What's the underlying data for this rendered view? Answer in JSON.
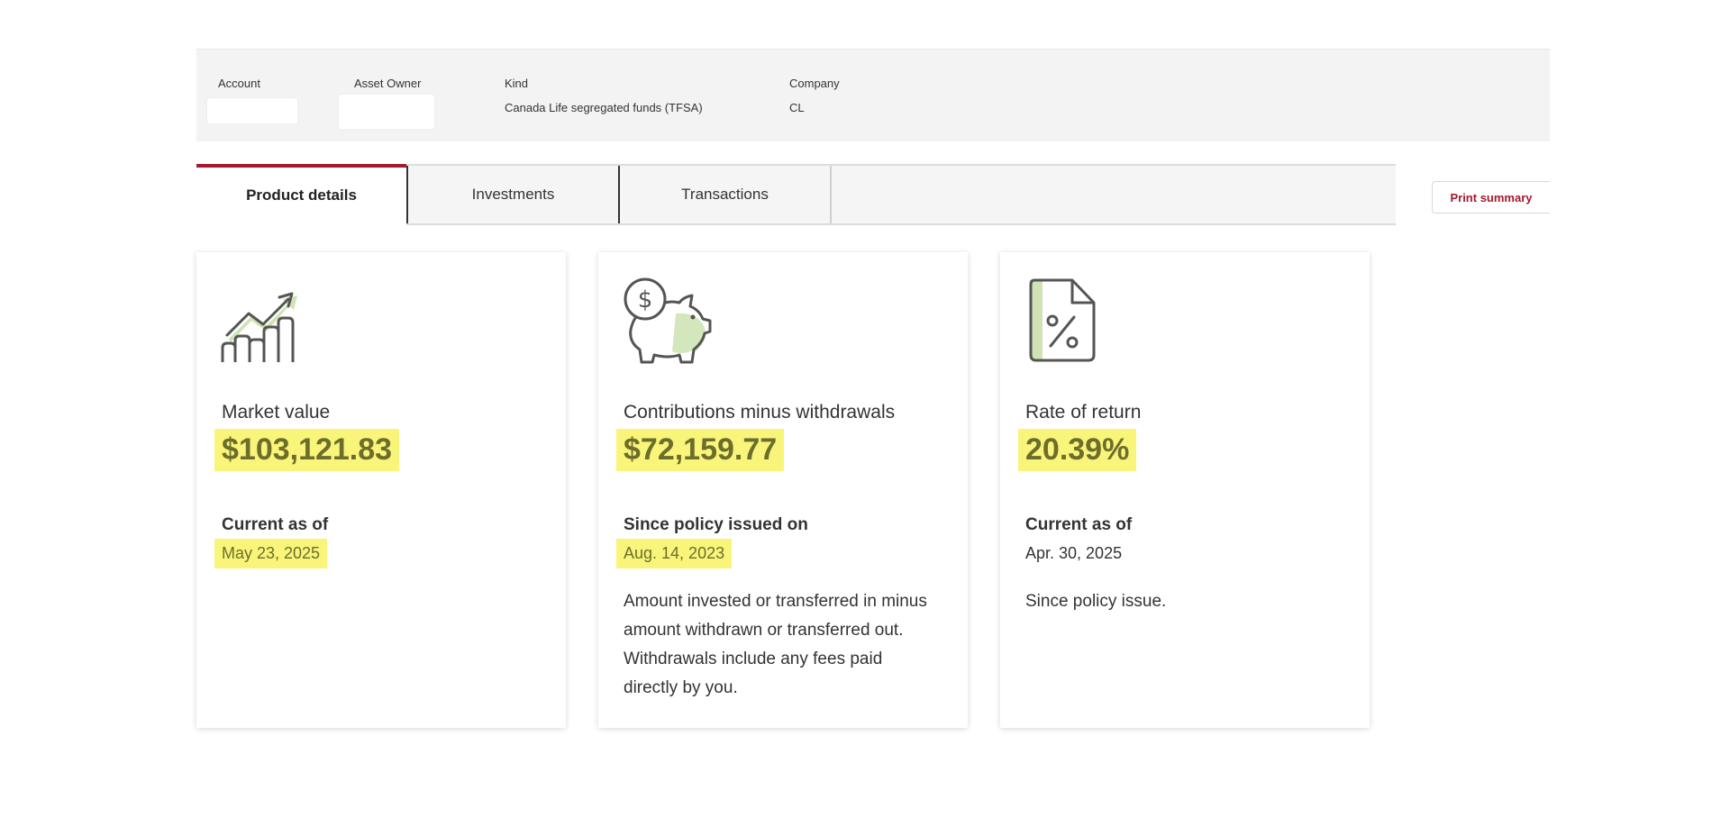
{
  "info_bar": {
    "account_label": "Account",
    "asset_owner_label": "Asset Owner",
    "kind_label": "Kind",
    "kind_value": "Canada Life segregated funds (TFSA)",
    "company_label": "Company",
    "company_value": "CL"
  },
  "tabs": [
    {
      "label": "Product details",
      "active": true
    },
    {
      "label": "Investments",
      "active": false
    },
    {
      "label": "Transactions",
      "active": false
    }
  ],
  "print_label": "Print summary",
  "cards": [
    {
      "icon": "growth-chart-icon",
      "title": "Market value",
      "value": "$103,121.83",
      "sub_label": "Current as of",
      "sub_value": "May 23, 2025",
      "description": ""
    },
    {
      "icon": "piggy-bank-icon",
      "title": "Contributions minus withdrawals",
      "value": "$72,159.77",
      "sub_label": "Since policy issued on",
      "sub_value": "Aug. 14, 2023",
      "description": "Amount invested or transferred in minus amount withdrawn or transferred out. Withdrawals include any fees paid directly by you."
    },
    {
      "icon": "percent-document-icon",
      "title": "Rate of return",
      "value": "20.39%",
      "sub_label": "Current as of",
      "sub_value": "Apr. 30, 2025",
      "description": "Since policy issue."
    }
  ],
  "colors": {
    "accent": "#a6192e",
    "highlight": "#f9f57a",
    "value_text": "#6d6d2c",
    "icon_green": "#cfe3b4"
  }
}
